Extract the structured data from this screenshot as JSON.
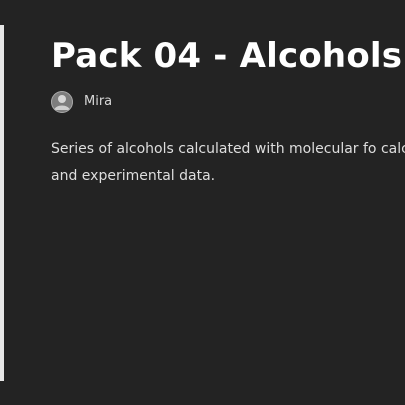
{
  "pack": {
    "title": "Pack 04 - Alcohols",
    "author": {
      "name": "Mira",
      "avatar_icon": "user-avatar-icon"
    },
    "description": "Series of alcohols calculated with molecular fo calculations and experimental data."
  },
  "colors": {
    "background": "#232323",
    "title": "#ffffff",
    "text": "#dedede",
    "left_rule": "#e6e6e6"
  }
}
